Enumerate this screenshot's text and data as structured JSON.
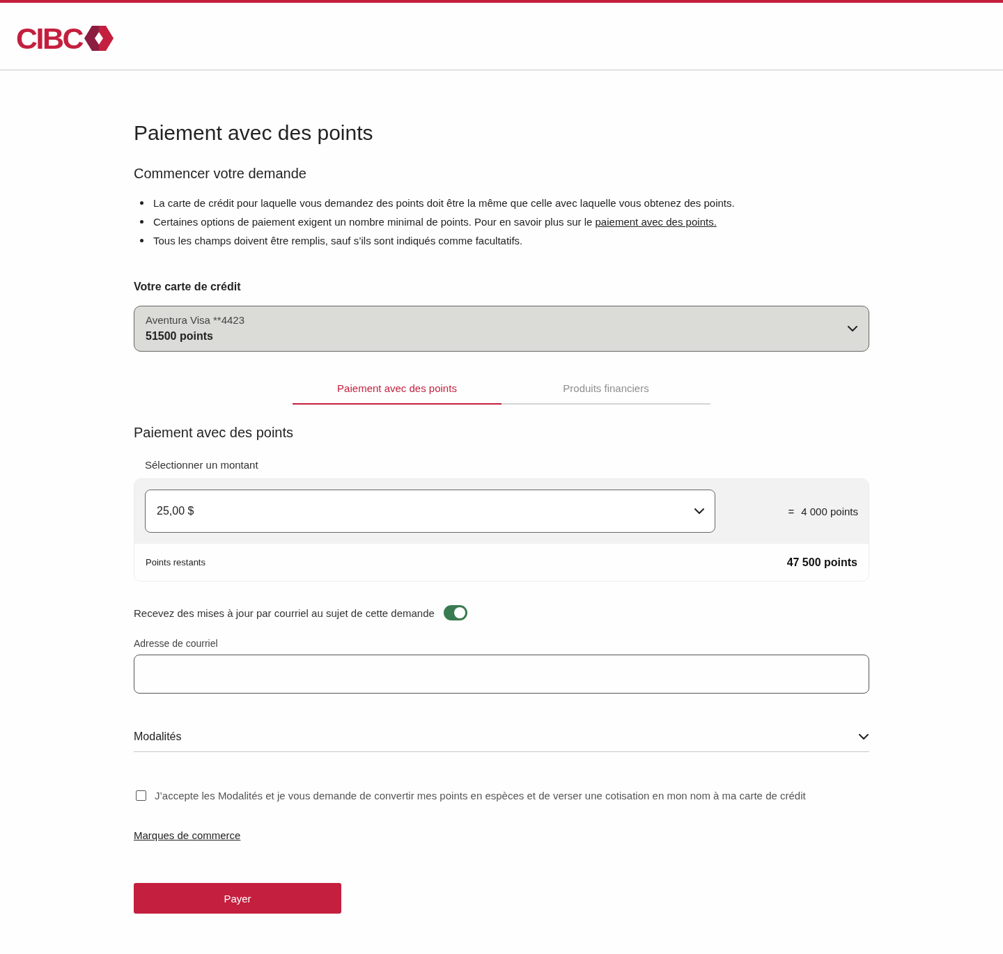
{
  "header": {
    "logo_text": "CIBC"
  },
  "page_title": "Paiement avec des points",
  "intro": {
    "heading": "Commencer votre demande",
    "bullets": [
      {
        "text": "La carte de crédit pour laquelle vous demandez des points doit être la même que celle avec laquelle vous obtenez des points."
      },
      {
        "text": "Certaines options de paiement exigent un nombre minimal de points. Pour en savoir plus sur le",
        "link": "paiement avec des points."
      },
      {
        "text": "Tous les champs doivent être remplis, sauf s’ils sont indiqués comme facultatifs."
      }
    ]
  },
  "credit_card": {
    "label": "Votre carte de crédit",
    "card_name": "Aventura Visa **4423",
    "points": "51500 points"
  },
  "tabs": [
    {
      "label": "Paiement avec des points",
      "selected": true
    },
    {
      "label": "Produits financiers",
      "selected": false
    }
  ],
  "payment": {
    "heading": "Paiement avec des points",
    "amount_label": "Sélectionner un montant",
    "amount_value": "25,00 $",
    "equals": "=",
    "points_cost": "4 000 points",
    "remaining_label": "Points restants",
    "remaining_value": "47 500 points"
  },
  "email_updates": {
    "label": "Recevez des mises à jour par courriel au sujet de cette demande",
    "on": true
  },
  "email": {
    "label": "Adresse de courriel"
  },
  "terms": {
    "title": "Modalités",
    "expanded": false
  },
  "consent": {
    "label": "J’accepte les Modalités et je vous demande de convertir mes points en espèces et de verser une cotisation en mon nom à ma carte de crédit",
    "checked": false
  },
  "trademarks_link": "Marques de commerce",
  "submit": "Payer"
}
